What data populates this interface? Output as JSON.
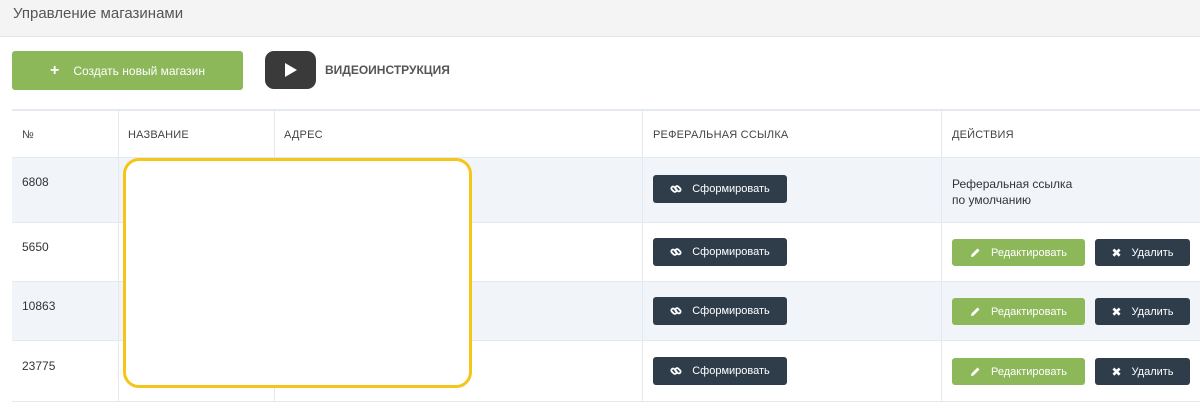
{
  "page": {
    "title": "Управление магазинами"
  },
  "toolbar": {
    "create_label": "Создать новый магазин",
    "create_icon": "plus-icon",
    "video_label": "ВИДЕОИНСТРУКЦИЯ",
    "video_icon": "play-icon"
  },
  "table": {
    "headers": {
      "num": "№",
      "name": "НАЗВАНИЕ",
      "address": "АДРЕС",
      "ref": "РЕФЕРАЛЬНАЯ ССЫЛКА",
      "actions": "ДЕЙСТВИЯ"
    },
    "rows": [
      {
        "num": "6808",
        "ref_button": "Сформировать",
        "default_line1": "Реферальная ссылка",
        "default_line2": "по умолчанию"
      },
      {
        "num": "5650",
        "ref_button": "Сформировать",
        "edit_button": "Редактировать",
        "delete_button": "Удалить"
      },
      {
        "num": "10863",
        "ref_button": "Сформировать",
        "edit_button": "Редактировать",
        "delete_button": "Удалить"
      },
      {
        "num": "23775",
        "ref_button": "Сформировать",
        "edit_button": "Редактировать",
        "delete_button": "Удалить"
      }
    ]
  },
  "colors": {
    "green": "#8db85a",
    "dark": "#2f3d4b",
    "redaction_border": "#f5c518"
  }
}
